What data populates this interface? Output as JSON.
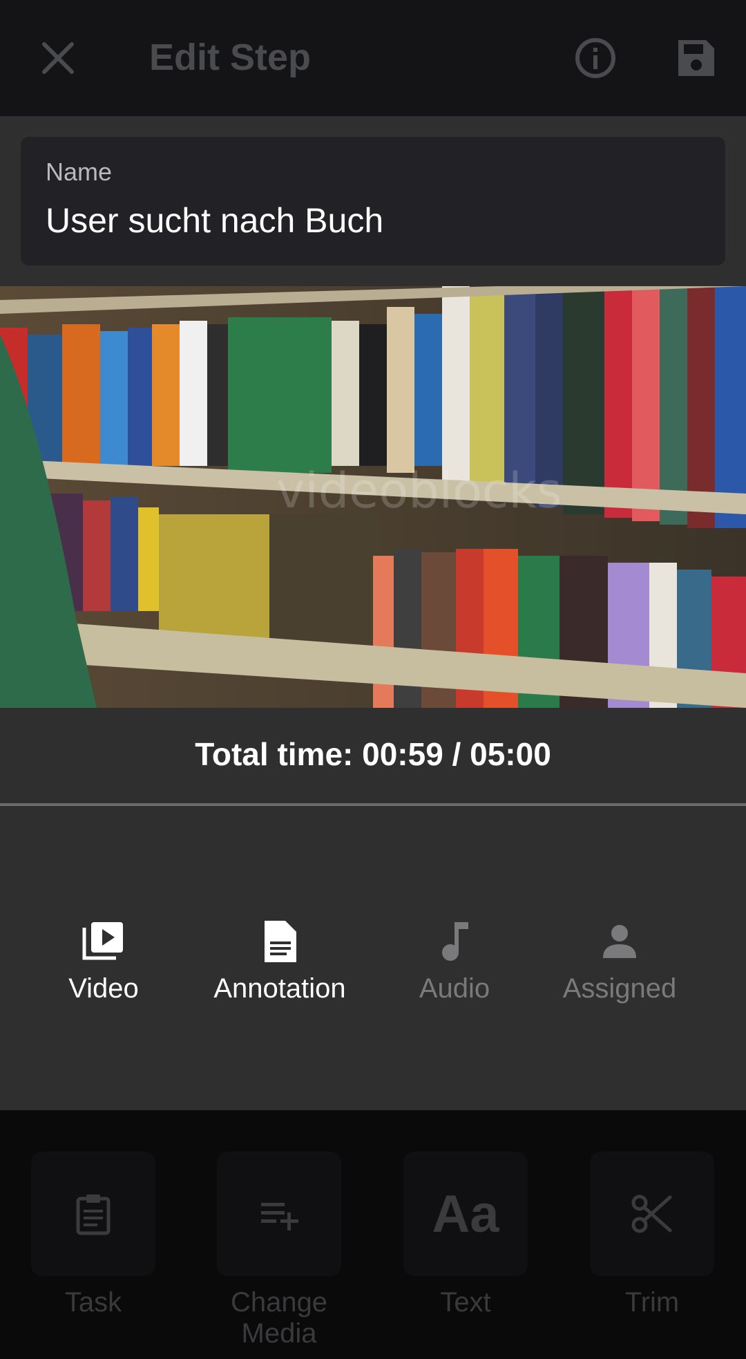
{
  "header": {
    "title": "Edit Step",
    "close_icon": "close-icon",
    "info_icon": "info-icon",
    "save_icon": "save-icon"
  },
  "name_field": {
    "label": "Name",
    "value": "User sucht nach Buch"
  },
  "video": {
    "watermark": "videoblocks"
  },
  "total_time": "Total time: 00:59 / 05:00",
  "media_tabs": [
    {
      "label": "Video",
      "icon": "video-library-icon",
      "active": true
    },
    {
      "label": "Annotation",
      "icon": "document-icon",
      "active": true
    },
    {
      "label": "Audio",
      "icon": "music-note-icon",
      "active": false
    },
    {
      "label": "Assigned",
      "icon": "person-icon",
      "active": false
    }
  ],
  "tools": [
    {
      "label": "Task",
      "icon": "clipboard-icon"
    },
    {
      "label": "Change Media",
      "icon": "playlist-add-icon"
    },
    {
      "label": "Text",
      "icon": "text-icon",
      "glyph": "Aa"
    },
    {
      "label": "Trim",
      "icon": "scissors-icon"
    }
  ],
  "colors": {
    "background": "#2f2f30",
    "header": "#141416",
    "card": "#222226",
    "active_text": "#ffffff",
    "inactive_text": "#7a7a7d"
  }
}
